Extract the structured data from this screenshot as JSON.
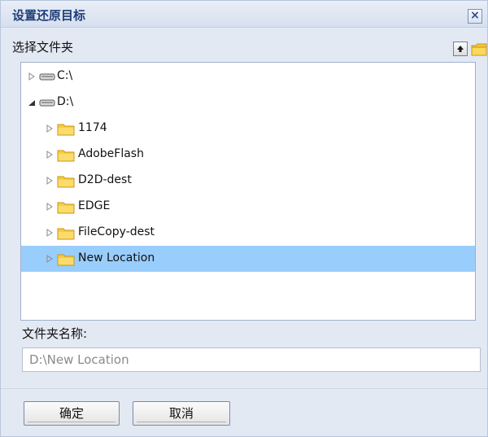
{
  "dialog": {
    "title": "设置还原目标",
    "close_label": "×",
    "select_folder_label": "选择文件夹"
  },
  "tree": {
    "items": [
      {
        "label": "C:\\",
        "type": "drive",
        "level": 0,
        "expanded": false,
        "selected": false
      },
      {
        "label": "D:\\",
        "type": "drive",
        "level": 0,
        "expanded": true,
        "selected": false
      },
      {
        "label": "1174",
        "type": "folder",
        "level": 1,
        "expanded": false,
        "selected": false
      },
      {
        "label": "AdobeFlash",
        "type": "folder",
        "level": 1,
        "expanded": false,
        "selected": false
      },
      {
        "label": "D2D-dest",
        "type": "folder",
        "level": 1,
        "expanded": false,
        "selected": false
      },
      {
        "label": "EDGE",
        "type": "folder",
        "level": 1,
        "expanded": false,
        "selected": false
      },
      {
        "label": "FileCopy-dest",
        "type": "folder",
        "level": 1,
        "expanded": false,
        "selected": false
      },
      {
        "label": "New Location",
        "type": "folder",
        "level": 1,
        "expanded": false,
        "selected": true
      }
    ]
  },
  "folder_name": {
    "label": "文件夹名称:",
    "value": "D:\\New Location"
  },
  "buttons": {
    "ok_label": "确定",
    "cancel_label": "取消"
  },
  "colors": {
    "selection": "#99cdfc",
    "dialog_bg": "#e3e9f3",
    "title_text": "#1f3d7a",
    "folder_yellow": "#f7cd3c"
  }
}
